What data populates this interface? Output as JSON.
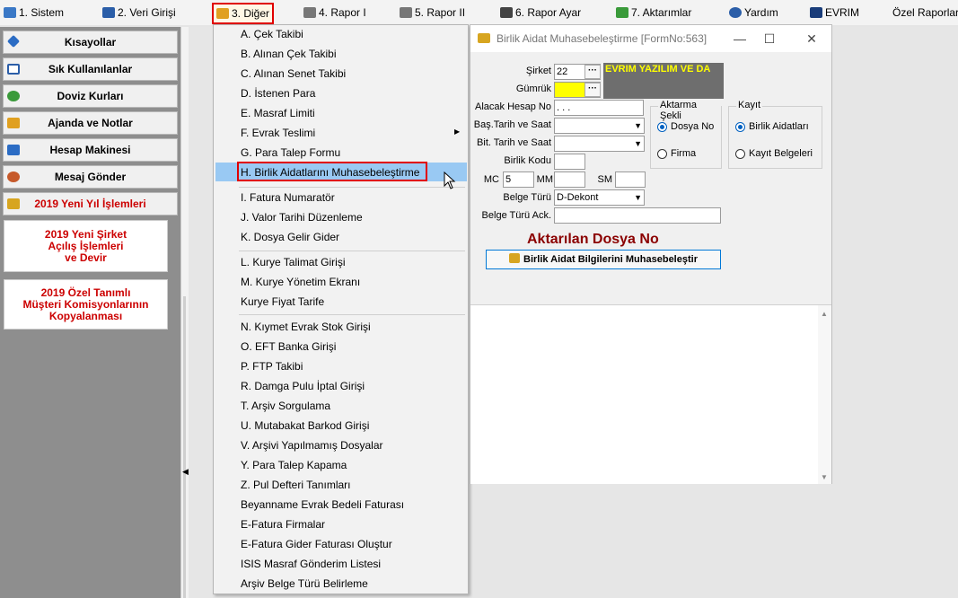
{
  "menubar": {
    "items": [
      {
        "label": "1.  Sistem",
        "icon": "system-icon",
        "color": "#3a78c6"
      },
      {
        "label": "2.  Veri Girişi",
        "icon": "data-entry-icon",
        "color": "#2b5ea8"
      },
      {
        "label": "3.  Diğer",
        "icon": "other-icon",
        "color": "#e0a020"
      },
      {
        "label": "4.  Rapor I",
        "icon": "printer-icon",
        "color": "#666666"
      },
      {
        "label": "5.  Rapor II",
        "icon": "printer-icon",
        "color": "#666666"
      },
      {
        "label": "6.  Rapor Ayar",
        "icon": "report-settings-icon",
        "color": "#444444"
      },
      {
        "label": "7.  Aktarımlar",
        "icon": "transfer-icon",
        "color": "#3a9a3a"
      },
      {
        "label": "Yardım",
        "icon": "help-icon",
        "color": "#2b5ea8"
      },
      {
        "label": "EVRIM",
        "icon": "evrim-icon",
        "color": "#1a3d7a"
      },
      {
        "label": "Özel Raporlar",
        "icon": "",
        "color": ""
      }
    ]
  },
  "sidebar": {
    "buttons": [
      {
        "label": "Kısayollar",
        "icon": "shortcut-icon"
      },
      {
        "label": "Sık Kullanılanlar",
        "icon": "favorites-icon"
      },
      {
        "label": "Doviz Kurları",
        "icon": "currency-icon"
      },
      {
        "label": "Ajanda ve Notlar",
        "icon": "agenda-icon"
      },
      {
        "label": "Hesap Makinesi",
        "icon": "calculator-icon"
      },
      {
        "label": "Mesaj Gönder",
        "icon": "message-icon"
      },
      {
        "label": "2019 Yeni Yıl İşlemleri",
        "icon": "new-year-icon"
      }
    ],
    "boxes": [
      {
        "lines": [
          "2019 Yeni Şirket",
          "Açılış İşlemleri",
          "ve Devir"
        ]
      },
      {
        "lines": [
          "2019 Özel Tanımlı",
          "Müşteri Komisyonlarının",
          "Kopyalanması"
        ]
      }
    ]
  },
  "dropdown": {
    "items": [
      "A.   Çek Takibi",
      "B.   Alınan Çek Takibi",
      "C.   Alınan Senet Takibi",
      "D.   İstenen Para",
      "E.   Masraf Limiti",
      "F.   Evrak Teslimi",
      "G.   Para Talep Formu",
      "H.   Birlik Aidatlarını Muhasebeleştirme",
      "I.   Fatura Numaratör",
      "J.   Valor Tarihi Düzenleme",
      "K.   Dosya Gelir Gider",
      "L.   Kurye Talimat Girişi",
      "M.   Kurye Yönetim Ekranı",
      "Kurye Fiyat Tarife",
      "N.   Kıymet Evrak Stok Girişi",
      "O.   EFT Banka Girişi",
      "P.   FTP Takibi",
      "R.   Damga Pulu İptal  Girişi",
      "T. Arşiv Sorgulama",
      "U. Mutabakat Barkod Girişi",
      "V. Arşivi Yapılmamış Dosyalar",
      "Y.  Para Talep Kapama",
      "Z. Pul Defteri Tanımları",
      "Beyanname Evrak Bedeli Faturası",
      "E-Fatura Firmalar",
      "E-Fatura Gider Faturası Oluştur",
      "ISIS Masraf Gönderim Listesi",
      "Arşiv Belge Türü Belirleme"
    ]
  },
  "form": {
    "title": "Birlik Aidat Muhasebeleştirme [FormNo:563]",
    "controls": {
      "minimize": "—",
      "maximize": "☐",
      "close": "✕"
    },
    "sirket_label": "Şirket",
    "sirket_value": "22",
    "sirket_name": "EVRIM YAZILIM  VE DA",
    "gumruk_label": "Gümrük",
    "gumruk_value": "",
    "alacak_label": "Alacak Hesap No",
    "alacak_value": "  .  .  .",
    "bas_label": "Baş.Tarih ve Saat",
    "bit_label": "Bit. Tarih ve Saat",
    "birlik_kodu_label": "Birlik Kodu",
    "mc_label": "MC",
    "mc_value": "5",
    "mm_label": "MM",
    "sm_label": "SM",
    "belge_turu_label": "Belge Türü",
    "belge_turu_value": "D-Dekont",
    "belge_turu_ack_label": "Belge Türü Ack.",
    "dot_button": "···",
    "combo_arrow": "▼",
    "aktarma_title": "Aktarma Şekli",
    "aktarma_options": [
      "Dosya No",
      "Firma"
    ],
    "kayit_title": "Kayıt",
    "kayit_options": [
      "Birlik Aidatları",
      "Kayıt Belgeleri"
    ],
    "aktarilan_text": "Aktarılan Dosya No",
    "button_label": "Birlik Aidat Bilgilerini Muhasebeleştir"
  },
  "colors": {
    "highlight": "#99c9f3",
    "red_outline": "#e00000",
    "yellow_field": "#ffff00",
    "name_bg": "#6e6e6e",
    "name_fg": "#ffff00"
  }
}
